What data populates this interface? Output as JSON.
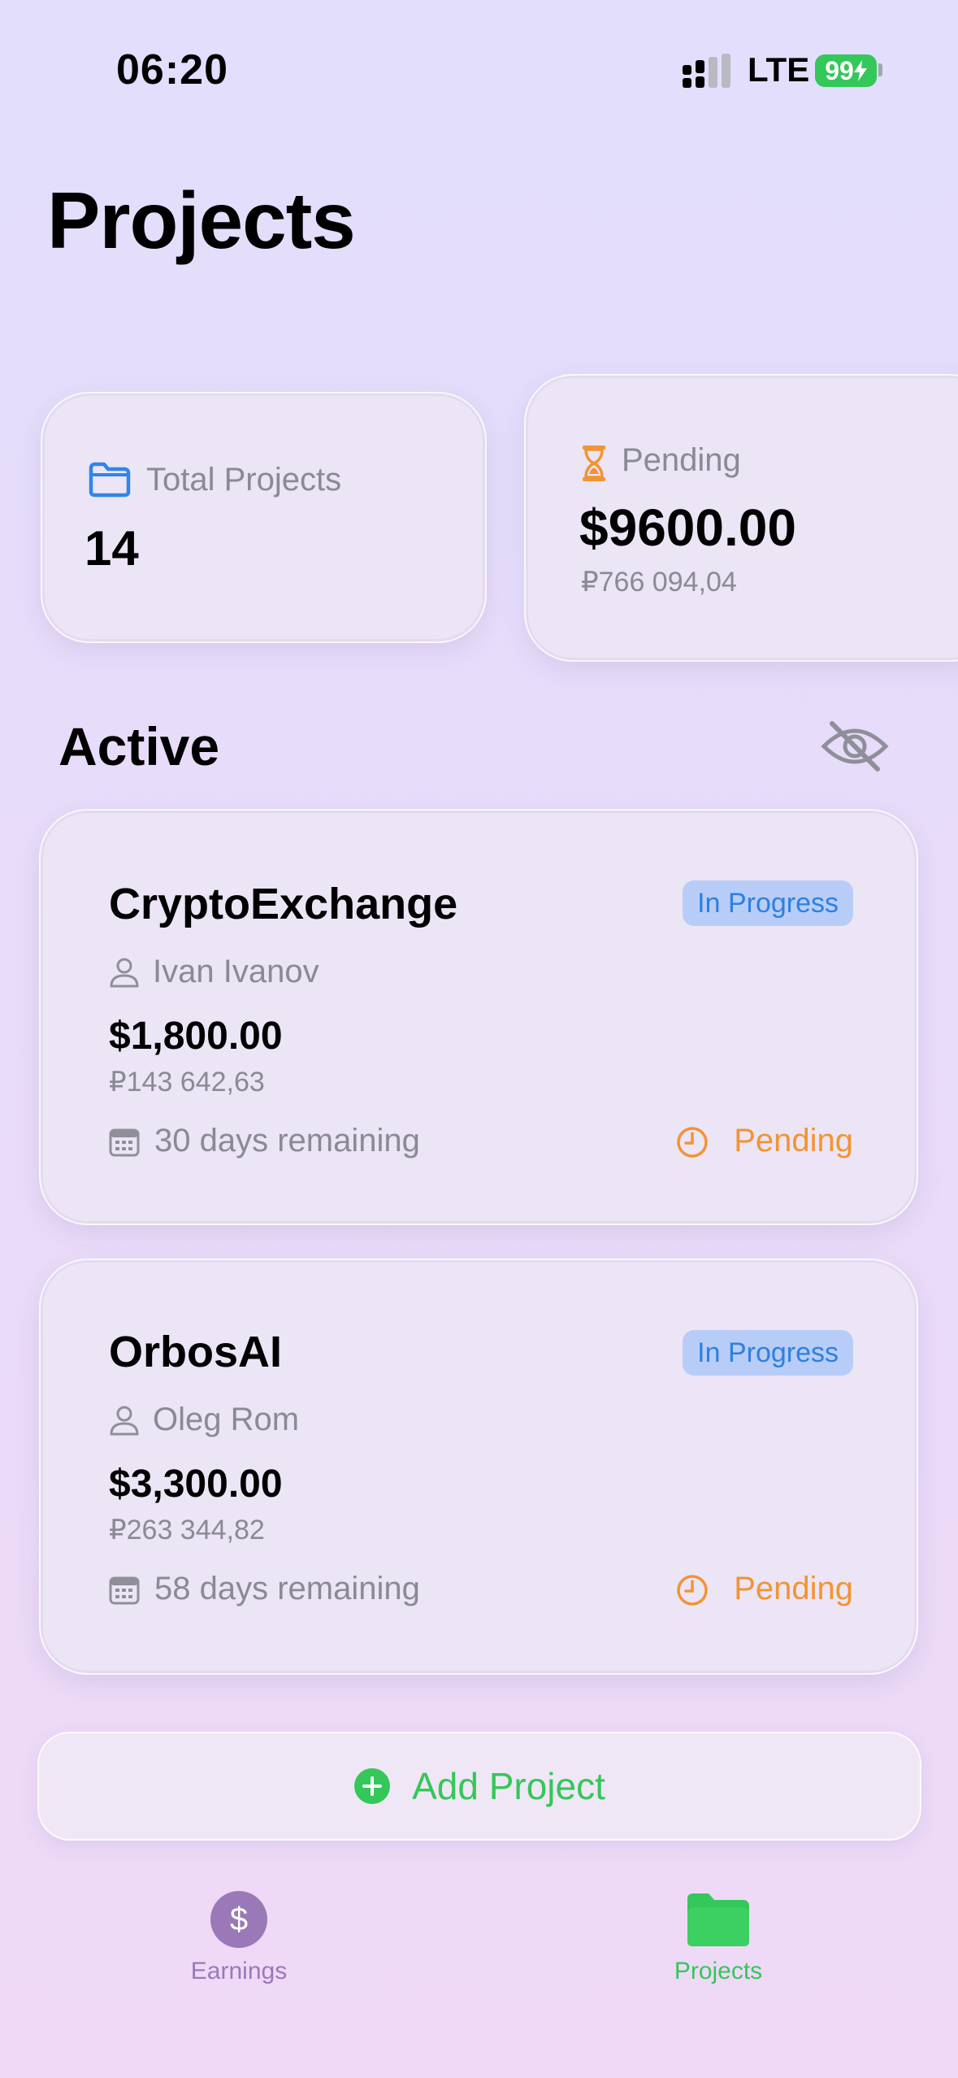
{
  "status": {
    "time": "06:20",
    "network": "LTE",
    "battery": "99"
  },
  "page": {
    "title": "Projects"
  },
  "stats": {
    "total": {
      "label": "Total Projects",
      "value": "14"
    },
    "pending": {
      "label": "Pending",
      "value": "$9600.00",
      "converted": "₽766 094,04"
    }
  },
  "section": {
    "title": "Active"
  },
  "projects": [
    {
      "name": "CryptoExchange",
      "status": "In Progress",
      "client": "Ivan Ivanov",
      "amount": "$1,800.00",
      "converted": "₽143 642,63",
      "remaining": "30 days remaining",
      "payment": "Pending"
    },
    {
      "name": "OrbosAI",
      "status": "In Progress",
      "client": "Oleg Rom",
      "amount": "$3,300.00",
      "converted": "₽263 344,82",
      "remaining": "58 days remaining",
      "payment": "Pending"
    }
  ],
  "actions": {
    "add": "Add Project"
  },
  "tabbar": {
    "earnings": "Earnings",
    "projects": "Projects"
  },
  "colors": {
    "accent_green": "#34c759",
    "pending_orange": "#f29433",
    "badge_blue": "#2f7fe0",
    "earnings_purple": "#9b79b8"
  }
}
